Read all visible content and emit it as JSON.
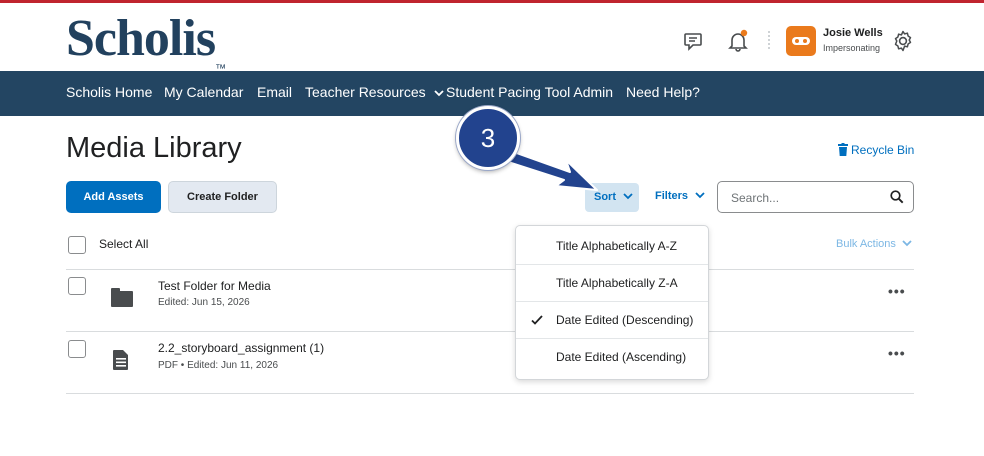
{
  "header": {
    "logo": "Scholis",
    "logo_mark": "™",
    "user_name": "Josie Wells",
    "user_role": "Impersonating",
    "icons": [
      "message-alerts-icon",
      "notification-bell-icon",
      "gear-icon"
    ],
    "notification_dot_color": "#ea7a1c"
  },
  "nav": {
    "items": [
      {
        "label": "Scholis Home"
      },
      {
        "label": "My Calendar"
      },
      {
        "label": "Email"
      },
      {
        "label": "Teacher Resources",
        "has_dropdown": true
      },
      {
        "label": "Student Pacing Tool Admin"
      },
      {
        "label": "Need Help?"
      }
    ]
  },
  "page": {
    "title": "Media Library",
    "recycle_bin": "Recycle Bin"
  },
  "toolbar": {
    "add_assets": "Add Assets",
    "create_folder": "Create Folder",
    "sort": "Sort",
    "filters": "Filters",
    "search_placeholder": "Search..."
  },
  "list": {
    "select_all": "Select All",
    "bulk_actions": "Bulk Actions",
    "items": [
      {
        "title": "Test Folder for Media",
        "meta": "Edited: Jun 15, 2026",
        "type_icon": "folder-icon"
      },
      {
        "title": "2.2_storyboard_assignment (1)",
        "meta_type": "PDF",
        "meta_sep": "•",
        "meta": "Edited: Jun 11, 2026",
        "type_icon": "document-icon"
      }
    ],
    "more_label": "•••"
  },
  "sort_menu": {
    "options": [
      {
        "label": "Title Alphabetically A-Z",
        "selected": false
      },
      {
        "label": "Title Alphabetically Z-A",
        "selected": false
      },
      {
        "label": "Date Edited (Descending)",
        "selected": true
      },
      {
        "label": "Date Edited (Ascending)",
        "selected": false
      }
    ]
  },
  "annotation": {
    "step_number": "3",
    "badge_color": "#22438e"
  }
}
